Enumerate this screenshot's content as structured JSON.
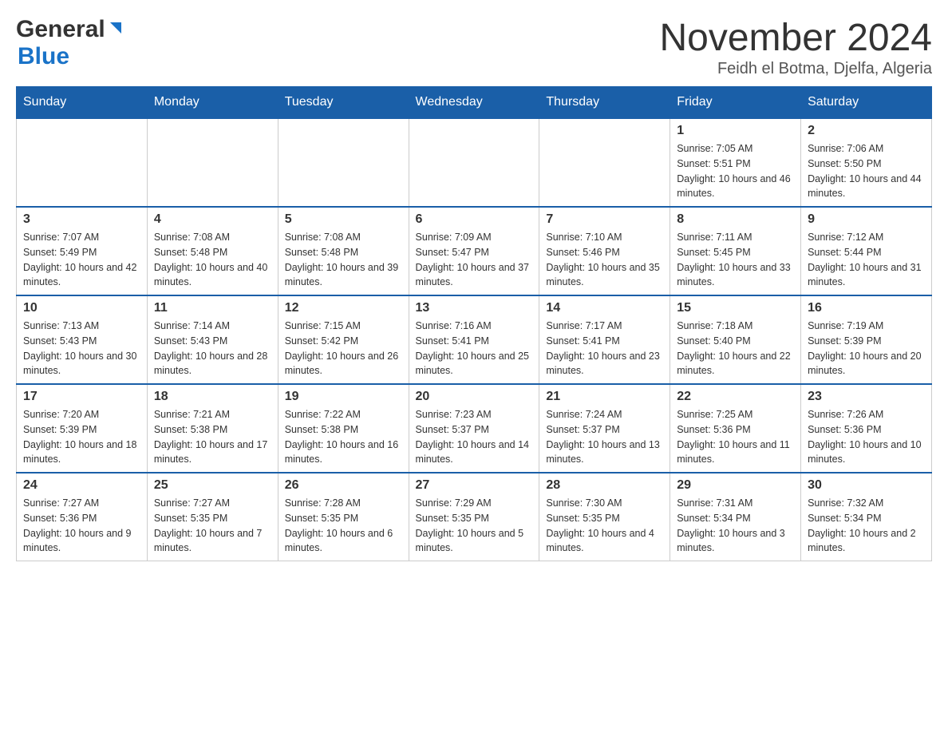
{
  "header": {
    "logo_general": "General",
    "logo_blue": "Blue",
    "month_title": "November 2024",
    "location": "Feidh el Botma, Djelfa, Algeria"
  },
  "weekdays": [
    "Sunday",
    "Monday",
    "Tuesday",
    "Wednesday",
    "Thursday",
    "Friday",
    "Saturday"
  ],
  "weeks": [
    [
      {
        "day": "",
        "info": ""
      },
      {
        "day": "",
        "info": ""
      },
      {
        "day": "",
        "info": ""
      },
      {
        "day": "",
        "info": ""
      },
      {
        "day": "",
        "info": ""
      },
      {
        "day": "1",
        "info": "Sunrise: 7:05 AM\nSunset: 5:51 PM\nDaylight: 10 hours and 46 minutes."
      },
      {
        "day": "2",
        "info": "Sunrise: 7:06 AM\nSunset: 5:50 PM\nDaylight: 10 hours and 44 minutes."
      }
    ],
    [
      {
        "day": "3",
        "info": "Sunrise: 7:07 AM\nSunset: 5:49 PM\nDaylight: 10 hours and 42 minutes."
      },
      {
        "day": "4",
        "info": "Sunrise: 7:08 AM\nSunset: 5:48 PM\nDaylight: 10 hours and 40 minutes."
      },
      {
        "day": "5",
        "info": "Sunrise: 7:08 AM\nSunset: 5:48 PM\nDaylight: 10 hours and 39 minutes."
      },
      {
        "day": "6",
        "info": "Sunrise: 7:09 AM\nSunset: 5:47 PM\nDaylight: 10 hours and 37 minutes."
      },
      {
        "day": "7",
        "info": "Sunrise: 7:10 AM\nSunset: 5:46 PM\nDaylight: 10 hours and 35 minutes."
      },
      {
        "day": "8",
        "info": "Sunrise: 7:11 AM\nSunset: 5:45 PM\nDaylight: 10 hours and 33 minutes."
      },
      {
        "day": "9",
        "info": "Sunrise: 7:12 AM\nSunset: 5:44 PM\nDaylight: 10 hours and 31 minutes."
      }
    ],
    [
      {
        "day": "10",
        "info": "Sunrise: 7:13 AM\nSunset: 5:43 PM\nDaylight: 10 hours and 30 minutes."
      },
      {
        "day": "11",
        "info": "Sunrise: 7:14 AM\nSunset: 5:43 PM\nDaylight: 10 hours and 28 minutes."
      },
      {
        "day": "12",
        "info": "Sunrise: 7:15 AM\nSunset: 5:42 PM\nDaylight: 10 hours and 26 minutes."
      },
      {
        "day": "13",
        "info": "Sunrise: 7:16 AM\nSunset: 5:41 PM\nDaylight: 10 hours and 25 minutes."
      },
      {
        "day": "14",
        "info": "Sunrise: 7:17 AM\nSunset: 5:41 PM\nDaylight: 10 hours and 23 minutes."
      },
      {
        "day": "15",
        "info": "Sunrise: 7:18 AM\nSunset: 5:40 PM\nDaylight: 10 hours and 22 minutes."
      },
      {
        "day": "16",
        "info": "Sunrise: 7:19 AM\nSunset: 5:39 PM\nDaylight: 10 hours and 20 minutes."
      }
    ],
    [
      {
        "day": "17",
        "info": "Sunrise: 7:20 AM\nSunset: 5:39 PM\nDaylight: 10 hours and 18 minutes."
      },
      {
        "day": "18",
        "info": "Sunrise: 7:21 AM\nSunset: 5:38 PM\nDaylight: 10 hours and 17 minutes."
      },
      {
        "day": "19",
        "info": "Sunrise: 7:22 AM\nSunset: 5:38 PM\nDaylight: 10 hours and 16 minutes."
      },
      {
        "day": "20",
        "info": "Sunrise: 7:23 AM\nSunset: 5:37 PM\nDaylight: 10 hours and 14 minutes."
      },
      {
        "day": "21",
        "info": "Sunrise: 7:24 AM\nSunset: 5:37 PM\nDaylight: 10 hours and 13 minutes."
      },
      {
        "day": "22",
        "info": "Sunrise: 7:25 AM\nSunset: 5:36 PM\nDaylight: 10 hours and 11 minutes."
      },
      {
        "day": "23",
        "info": "Sunrise: 7:26 AM\nSunset: 5:36 PM\nDaylight: 10 hours and 10 minutes."
      }
    ],
    [
      {
        "day": "24",
        "info": "Sunrise: 7:27 AM\nSunset: 5:36 PM\nDaylight: 10 hours and 9 minutes."
      },
      {
        "day": "25",
        "info": "Sunrise: 7:27 AM\nSunset: 5:35 PM\nDaylight: 10 hours and 7 minutes."
      },
      {
        "day": "26",
        "info": "Sunrise: 7:28 AM\nSunset: 5:35 PM\nDaylight: 10 hours and 6 minutes."
      },
      {
        "day": "27",
        "info": "Sunrise: 7:29 AM\nSunset: 5:35 PM\nDaylight: 10 hours and 5 minutes."
      },
      {
        "day": "28",
        "info": "Sunrise: 7:30 AM\nSunset: 5:35 PM\nDaylight: 10 hours and 4 minutes."
      },
      {
        "day": "29",
        "info": "Sunrise: 7:31 AM\nSunset: 5:34 PM\nDaylight: 10 hours and 3 minutes."
      },
      {
        "day": "30",
        "info": "Sunrise: 7:32 AM\nSunset: 5:34 PM\nDaylight: 10 hours and 2 minutes."
      }
    ]
  ]
}
